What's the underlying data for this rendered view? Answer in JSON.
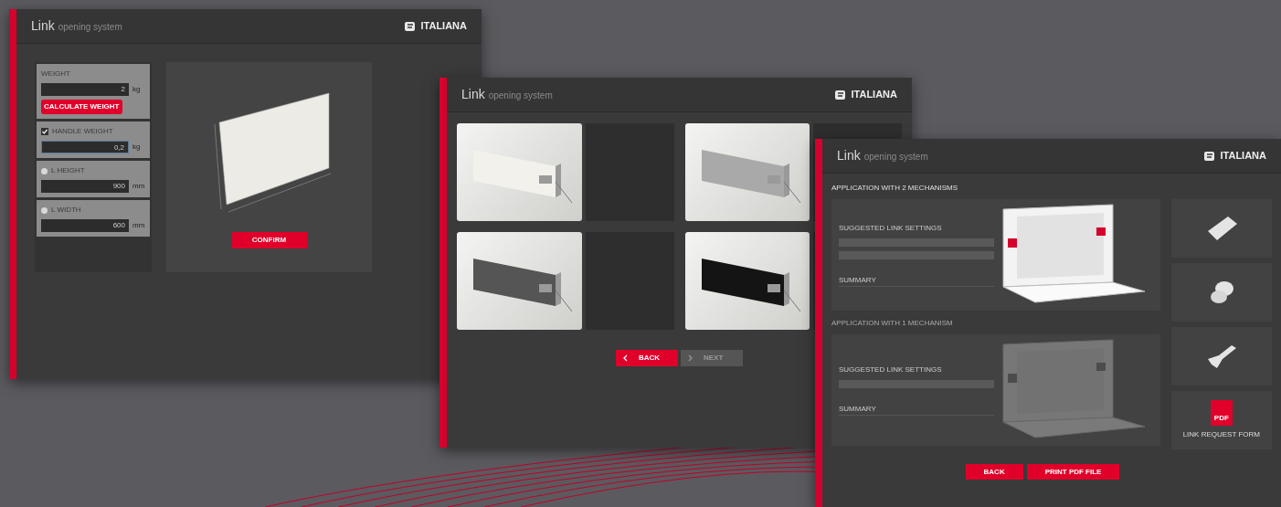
{
  "calculator_window": {
    "header": {
      "title": "Link",
      "subtitle": "opening system",
      "logo": "ITALIANA"
    },
    "fields": [
      {
        "kind": "input",
        "label": "WEIGHT",
        "value": "2",
        "unit": "kg",
        "action": "CALCULATE WEIGHT"
      },
      {
        "kind": "checkbox",
        "label": "HANDLE WEIGHT",
        "checked": true,
        "value": "0,2",
        "unit": "kg"
      },
      {
        "kind": "radio",
        "label": "L HEIGHT",
        "selected": false,
        "value": "900",
        "unit": "mm"
      },
      {
        "kind": "radio",
        "label": "L WIDTH",
        "selected": false,
        "value": "600",
        "unit": "mm"
      }
    ],
    "confirm": "CONFIRM"
  },
  "finish_window": {
    "header": {
      "title": "Link",
      "subtitle": "opening system",
      "logo": "ITALIANA"
    },
    "finishes": [
      {
        "color": "#f2f1ec"
      },
      {
        "color": "#a9a9a9"
      },
      {
        "color": "#555555"
      },
      {
        "color": "#141414"
      }
    ],
    "buttons": [
      {
        "label": "BACK",
        "disabled": false
      },
      {
        "label": "NEXT",
        "disabled": true
      }
    ]
  },
  "result_window": {
    "header": {
      "title": "Link",
      "subtitle": "opening system",
      "logo": "ITALIANA"
    },
    "sections": [
      {
        "title": "APPLICATION WITH 2 MECHANISMS",
        "settings_label": "SUGGESTED LINK SETTINGS",
        "summary_label": "SUMMARY",
        "disabled": false
      },
      {
        "title": "APPLICATION WITH 1 MECHANISM",
        "settings_label": "SUGGESTED LINK SETTINGS",
        "summary_label": "SUMMARY",
        "disabled": true
      }
    ],
    "side_cards": [
      {
        "kind": "plate"
      },
      {
        "kind": "clip"
      },
      {
        "kind": "hinge"
      },
      {
        "kind": "pdf",
        "label": "LINK REQUEST FORM",
        "badge": "PDF"
      }
    ],
    "buttons": [
      "BACK",
      "PRINT PDF FILE"
    ]
  }
}
